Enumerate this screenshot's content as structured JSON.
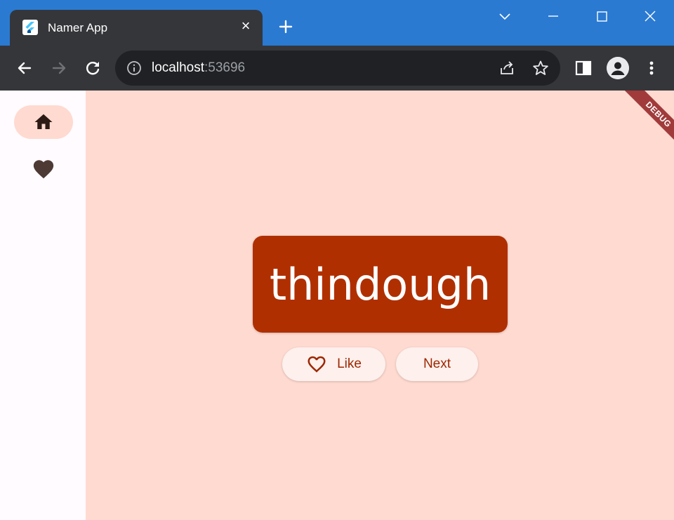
{
  "tab": {
    "title": "Namer App",
    "close_glyph": "×",
    "favicon": "flutter-icon"
  },
  "address_bar": {
    "host": "localhost",
    "port": ":53696"
  },
  "nav_rail": {
    "items": [
      {
        "icon": "home-icon",
        "selected": true
      },
      {
        "icon": "favorite-icon",
        "selected": false
      }
    ]
  },
  "main": {
    "word": "thindough",
    "like_label": "Like",
    "next_label": "Next"
  },
  "debug_banner": "DEBUG",
  "colors": {
    "accent": "#b02f00",
    "background": "#ffdad0",
    "browser_frame": "#2a7ad2"
  }
}
